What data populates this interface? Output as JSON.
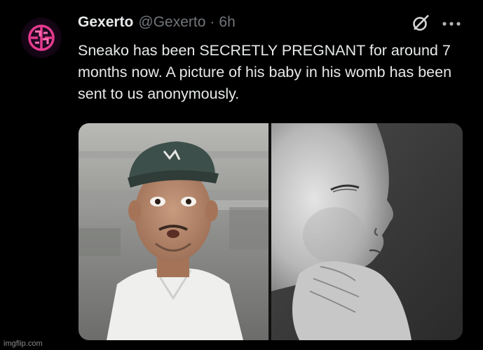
{
  "tweet": {
    "author_name": "Gexerto",
    "handle": "@Gexerto",
    "separator": "·",
    "time": "6h",
    "text": "Sneako has been SECRETLY PREGNANT for around 7 months now. A picture of his baby in his womb has been sent to us anonymously."
  },
  "icons": {
    "avatar": "gexerto-logo-avatar",
    "grok": "grok-icon",
    "more": "more-options-icon"
  },
  "colors": {
    "background": "#000000",
    "text": "#e7e9ea",
    "secondary": "#71767b",
    "logo_accent": "#e53a8e"
  },
  "watermark": "imgflip.com"
}
